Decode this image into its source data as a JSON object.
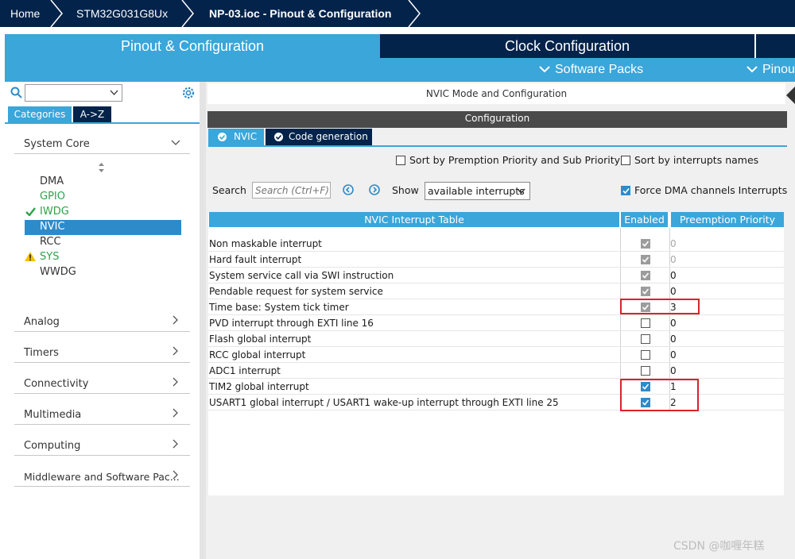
{
  "breadcrumb": {
    "items": [
      "Home",
      "STM32G031G8Ux",
      "NP-03.ioc - Pinout & Configuration"
    ]
  },
  "main_tabs": {
    "pinout": "Pinout & Configuration",
    "clock": "Clock Configuration",
    "software_packs": "Software Packs",
    "pinout_menu": "Pinou"
  },
  "left": {
    "search_value": "",
    "tabs": {
      "categories": "Categories",
      "az": "A->Z"
    },
    "system_core": {
      "label": "System Core",
      "items": [
        {
          "label": "DMA",
          "status": "none"
        },
        {
          "label": "GPIO",
          "status": "green"
        },
        {
          "label": "IWDG",
          "status": "check"
        },
        {
          "label": "NVIC",
          "status": "selected"
        },
        {
          "label": "RCC",
          "status": "none"
        },
        {
          "label": "SYS",
          "status": "warning"
        },
        {
          "label": "WWDG",
          "status": "none"
        }
      ]
    },
    "categories": [
      "Analog",
      "Timers",
      "Connectivity",
      "Multimedia",
      "Computing",
      "Middleware and Software Pac..."
    ]
  },
  "right": {
    "title": "NVIC Mode and Configuration",
    "config_label": "Configuration",
    "tabs": {
      "nvic": "NVIC",
      "code_gen": "Code generation"
    },
    "sort_preemption": "Sort by Premption Priority and Sub Priority",
    "sort_names": "Sort by interrupts names",
    "search_label": "Search",
    "search_placeholder": "Search (Ctrl+F)",
    "show_label": "Show",
    "show_value": "available interrupts",
    "force_dma": "Force DMA channels Interrupts",
    "table": {
      "headers": [
        "NVIC Interrupt Table",
        "Enabled",
        "Preemption Priority"
      ],
      "rows": [
        {
          "name": "Non maskable interrupt",
          "enabled": true,
          "locked": true,
          "priority": "0"
        },
        {
          "name": "Hard fault interrupt",
          "enabled": true,
          "locked": true,
          "priority": "0"
        },
        {
          "name": "System service call via SWI instruction",
          "enabled": true,
          "locked": true,
          "priority": "0"
        },
        {
          "name": "Pendable request for system service",
          "enabled": true,
          "locked": true,
          "priority": "0"
        },
        {
          "name": "Time base: System tick timer",
          "enabled": true,
          "locked": true,
          "priority": "3"
        },
        {
          "name": "PVD interrupt through EXTI line 16",
          "enabled": false,
          "locked": false,
          "priority": "0"
        },
        {
          "name": "Flash global interrupt",
          "enabled": false,
          "locked": false,
          "priority": "0"
        },
        {
          "name": "RCC global interrupt",
          "enabled": false,
          "locked": false,
          "priority": "0"
        },
        {
          "name": "ADC1 interrupt",
          "enabled": false,
          "locked": false,
          "priority": "0"
        },
        {
          "name": "TIM2 global interrupt",
          "enabled": true,
          "locked": false,
          "priority": "1"
        },
        {
          "name": "USART1 global interrupt / USART1 wake-up interrupt through EXTI line 25",
          "enabled": true,
          "locked": false,
          "priority": "2"
        }
      ]
    }
  },
  "watermark": "CSDN @咖喱年糕",
  "colors": {
    "navy": "#03234b",
    "accent": "#3aa6d9",
    "dark_gray": "#4a4a4a",
    "highlight_red": "#d9232a",
    "green": "#2ea34a"
  }
}
